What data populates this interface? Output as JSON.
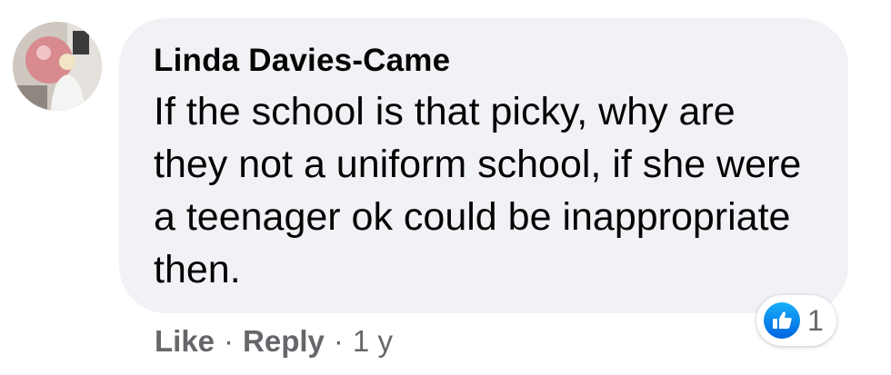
{
  "comment": {
    "author": "Linda Davies-Came",
    "text": "If the school is that picky, why are they not a uniform school, if she were a teenager ok could be inappropriate then."
  },
  "actions": {
    "like_label": "Like",
    "separator": "·",
    "reply_label": "Reply",
    "timestamp": "1 y"
  },
  "reactions": {
    "icon": "thumbs-up-icon",
    "count": "1"
  },
  "colors": {
    "bubble_bg": "#f0f2f5",
    "text": "#050505",
    "secondary_text": "#65676b",
    "like_blue": "#1877f2"
  }
}
